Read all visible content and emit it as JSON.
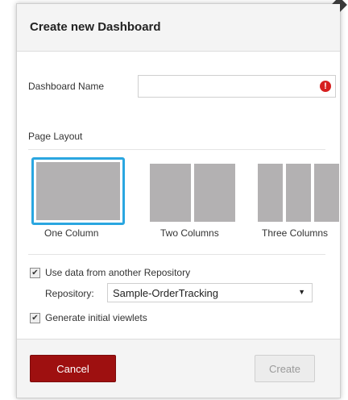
{
  "dialog": {
    "title": "Create new Dashboard"
  },
  "name_field": {
    "label": "Dashboard Name",
    "value": "",
    "error_icon": "exclamation-error-icon"
  },
  "page_layout": {
    "label": "Page Layout",
    "options": [
      {
        "label": "One Column",
        "columns": 1,
        "selected": true
      },
      {
        "label": "Two Columns",
        "columns": 2,
        "selected": false
      },
      {
        "label": "Three Columns",
        "columns": 3,
        "selected": false
      }
    ]
  },
  "options": {
    "use_other_repo_label": "Use data from another Repository",
    "use_other_repo_checked": true,
    "repository_label": "Repository:",
    "repository_value": "Sample-OrderTracking",
    "generate_viewlets_label": "Generate initial viewlets",
    "generate_viewlets_checked": true
  },
  "buttons": {
    "cancel": "Cancel",
    "create": "Create"
  },
  "colors": {
    "cancel_bg": "#9e1010",
    "selected_border": "#2aa6e0",
    "error": "#d61f1f"
  }
}
